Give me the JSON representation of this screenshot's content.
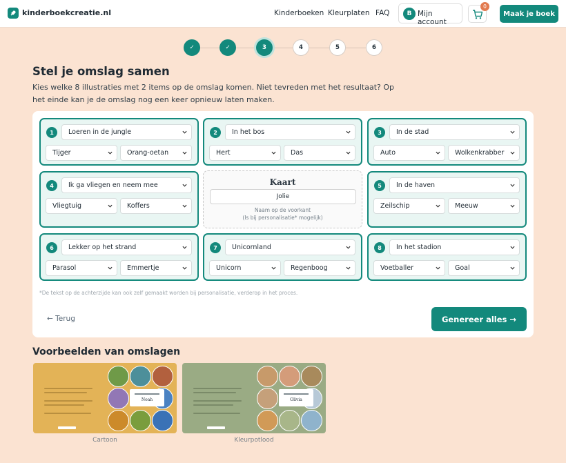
{
  "header": {
    "brand": "kinderboekcreatie.nl",
    "nav": [
      "Kinderboeken",
      "Kleurplaten",
      "FAQ"
    ],
    "account_initial": "B",
    "account_label": "Mijn account",
    "cart_count": "0",
    "cta": "Maak je boek"
  },
  "stepper": {
    "steps": [
      "✓",
      "✓",
      "3",
      "4",
      "5",
      "6"
    ],
    "current": 3
  },
  "heading": "Stel je omslag samen",
  "intro": "Kies welke 8 illustraties met 2 items op de omslag komen. Niet tevreden met het resultaat? Op het einde kan je de omslag nog een keer opnieuw laten maken.",
  "cards": [
    {
      "num": "1",
      "theme": "Loeren in de jungle",
      "item1": "Tijger",
      "item2": "Orang-oetan"
    },
    {
      "num": "2",
      "theme": "In het bos",
      "item1": "Hert",
      "item2": "Das"
    },
    {
      "num": "3",
      "theme": "In de stad",
      "item1": "Auto",
      "item2": "Wolkenkrabber"
    },
    {
      "num": "4",
      "theme": "Ik ga vliegen en neem mee",
      "item1": "Vliegtuig",
      "item2": "Koffers"
    },
    {
      "num": "5",
      "theme": "In de haven",
      "item1": "Zeilschip",
      "item2": "Meeuw"
    },
    {
      "num": "6",
      "theme": "Lekker op het strand",
      "item1": "Parasol",
      "item2": "Emmertje"
    },
    {
      "num": "7",
      "theme": "Unicornland",
      "item1": "Unicorn",
      "item2": "Regenboog"
    },
    {
      "num": "8",
      "theme": "In het stadion",
      "item1": "Voetballer",
      "item2": "Goal"
    }
  ],
  "kaart": {
    "title": "Kaart",
    "name_value": "Jolie",
    "caption1": "Naam op de voorkant",
    "caption2": "(Is bij personalisatie* mogelijk)"
  },
  "footnote": "*De tekst op de achterzijde kan ook zelf gemaakt worden bij personalisatie, verderop in het proces.",
  "back_label": "← Terug",
  "generate_label": "Genereer alles →",
  "examples": {
    "heading": "Voorbeelden van omslagen",
    "items": [
      {
        "caption": "Cartoon",
        "name": "Noah",
        "bg": "#e3b357"
      },
      {
        "caption": "Kleurpotlood",
        "name": "Olivia",
        "bg": "#9aab84"
      }
    ]
  },
  "colors": {
    "accent": "#13897c",
    "background": "#fbe3d2",
    "badge": "#e27a4f"
  }
}
